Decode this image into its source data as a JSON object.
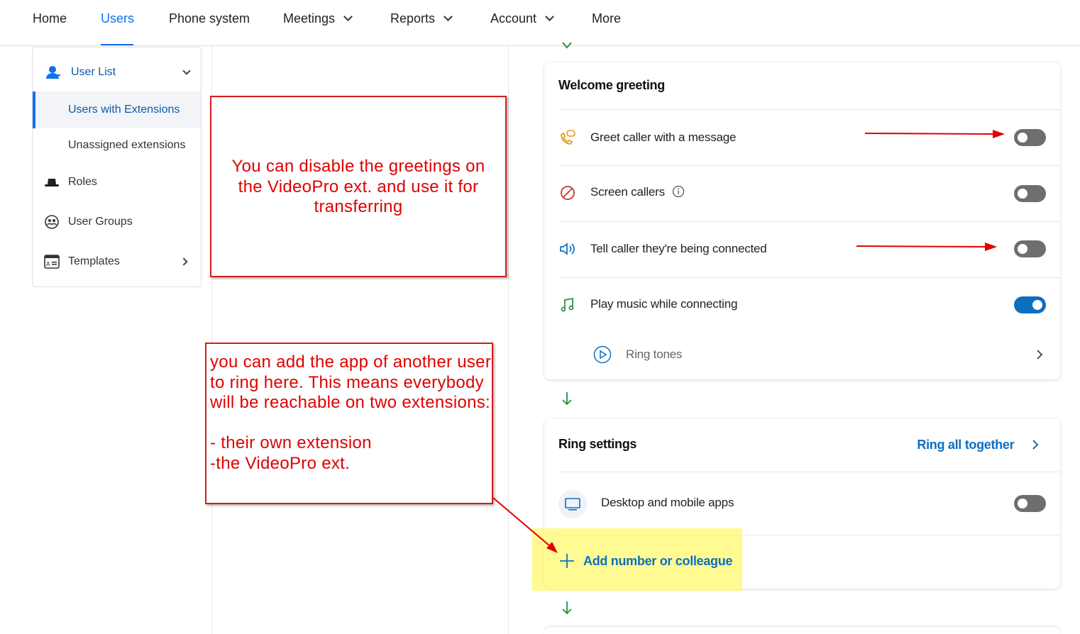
{
  "nav": {
    "items": [
      {
        "label": "Home"
      },
      {
        "label": "Users",
        "active": true
      },
      {
        "label": "Phone system"
      },
      {
        "label": "Meetings",
        "dropdown": true
      },
      {
        "label": "Reports",
        "dropdown": true
      },
      {
        "label": "Account",
        "dropdown": true
      },
      {
        "label": "More"
      }
    ]
  },
  "sidebar": {
    "user_list": "User List",
    "users_with_extensions": "Users with Extensions",
    "unassigned_extensions": "Unassigned extensions",
    "roles": "Roles",
    "user_groups": "User Groups",
    "templates": "Templates"
  },
  "welcome": {
    "title": "Welcome greeting",
    "greet_caller": {
      "label": "Greet caller with a message",
      "enabled": false
    },
    "screen_callers": {
      "label": "Screen callers",
      "enabled": false
    },
    "tell_caller": {
      "label": "Tell caller they're being connected",
      "enabled": false
    },
    "play_music": {
      "label": "Play music while connecting",
      "enabled": true
    },
    "ring_tones": "Ring tones"
  },
  "ring": {
    "title": "Ring settings",
    "mode": "Ring all together",
    "desktop_apps": {
      "label": "Desktop and mobile apps",
      "enabled": false
    },
    "add_number": "Add number or colleague"
  },
  "annotations": {
    "box1": "You can disable the greetings on the VideoPro ext. and use it for transferring",
    "box2": "you can add the app of another user to ring here. This means everybody will be reachable on two extensions:\n\n- their own extension\n-the  VideoPro ext."
  },
  "colors": {
    "accent": "#0e72ed",
    "toggle_on": "#0e6fbf",
    "toggle_off": "#6e6e6e",
    "annotation_red": "#e00000",
    "highlight_yellow": "#fffa6e"
  }
}
